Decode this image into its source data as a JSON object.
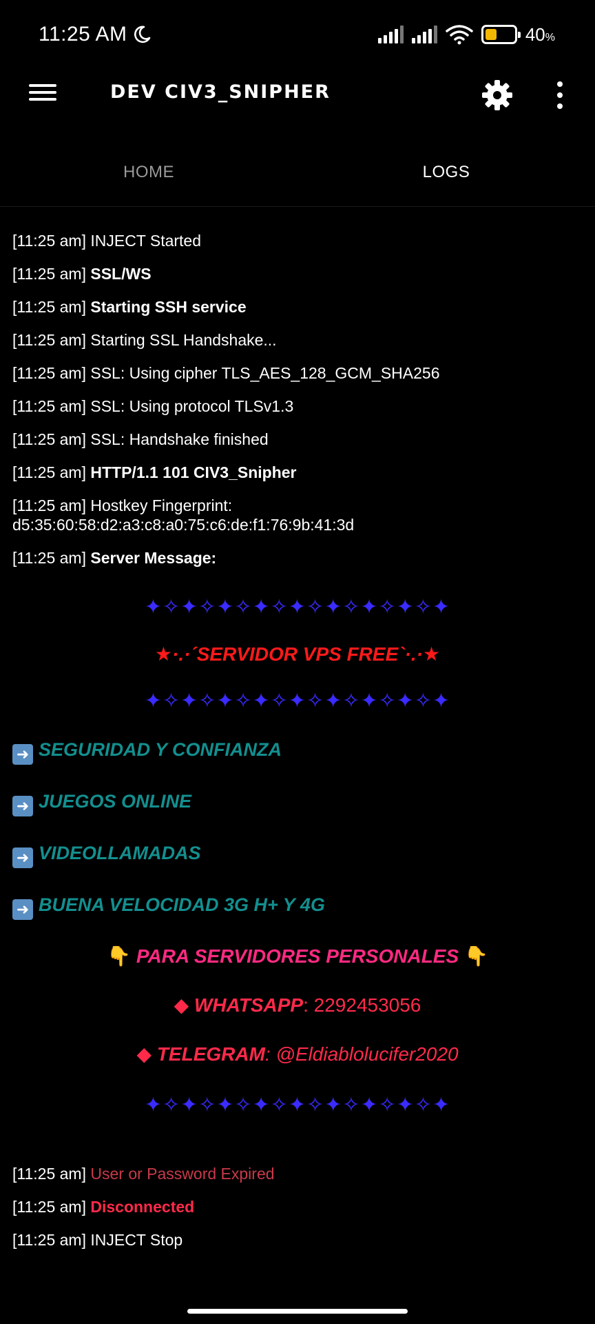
{
  "status_bar": {
    "time": "11:25 AM",
    "battery_percent": "40",
    "battery_unit": "%"
  },
  "app_bar": {
    "title": "DEV CIV3_SNIPHER"
  },
  "tabs": [
    {
      "label": "HOME"
    },
    {
      "label": "LOGS"
    }
  ],
  "logs": {
    "l1": {
      "time": "[11:25 am]",
      "text": "INJECT Started"
    },
    "l2": {
      "time": "[11:25 am]",
      "text": "SSL/WS"
    },
    "l3": {
      "time": "[11:25 am]",
      "text": "Starting SSH service"
    },
    "l4": {
      "time": "[11:25 am]",
      "text": "Starting SSL Handshake..."
    },
    "l5": {
      "time": "[11:25 am]",
      "text": "SSL: Using cipher TLS_AES_128_GCM_SHA256"
    },
    "l6": {
      "time": "[11:25 am]",
      "text": "SSL: Using protocol TLSv1.3"
    },
    "l7": {
      "time": "[11:25 am]",
      "text": "SSL: Handshake finished"
    },
    "l8": {
      "time": "[11:25 am]",
      "text": "HTTP/1.1 101 CIV3_Snipher"
    },
    "l9": {
      "time": "[11:25 am]",
      "text": "Hostkey Fingerprint:",
      "text2": "d5:35:60:58:d2:a3:c8:a0:75:c6:de:f1:76:9b:41:3d"
    },
    "l10": {
      "time": "[11:25 am]",
      "text": "Server Message:"
    },
    "l11": {
      "time": "[11:25 am]",
      "text": "User or Password Expired"
    },
    "l12": {
      "time": "[11:25 am]",
      "text": "Disconnected"
    },
    "l13": {
      "time": "[11:25 am]",
      "text": "INJECT Stop"
    }
  },
  "server_message": {
    "stars_1": "✦✧✦✧✦✧✦✧✦✧✦✧✦✧✦✧✦",
    "banner": "★·.·´SERVIDOR VPS FREE`·.·★",
    "stars_2": "✦✧✦✧✦✧✦✧✦✧✦✧✦✧✦✧✦",
    "features": [
      {
        "text": "SEGURIDAD Y CONFIANZA"
      },
      {
        "text": "JUEGOS ONLINE"
      },
      {
        "text": "VIDEOLLAMADAS"
      },
      {
        "text": "BUENA VELOCIDAD 3G H+ Y 4G"
      }
    ],
    "personal": "PARA SERVIDORES PERSONALES",
    "whatsapp_label": "WHATSAPP",
    "whatsapp_value": ": 2292453056",
    "telegram_label": "TELEGRAM",
    "telegram_value": ": @Eldiablolucifer2020",
    "stars_3": "✦✧✦✧✦✧✦✧✦✧✦✧✦✧✦✧✦"
  }
}
